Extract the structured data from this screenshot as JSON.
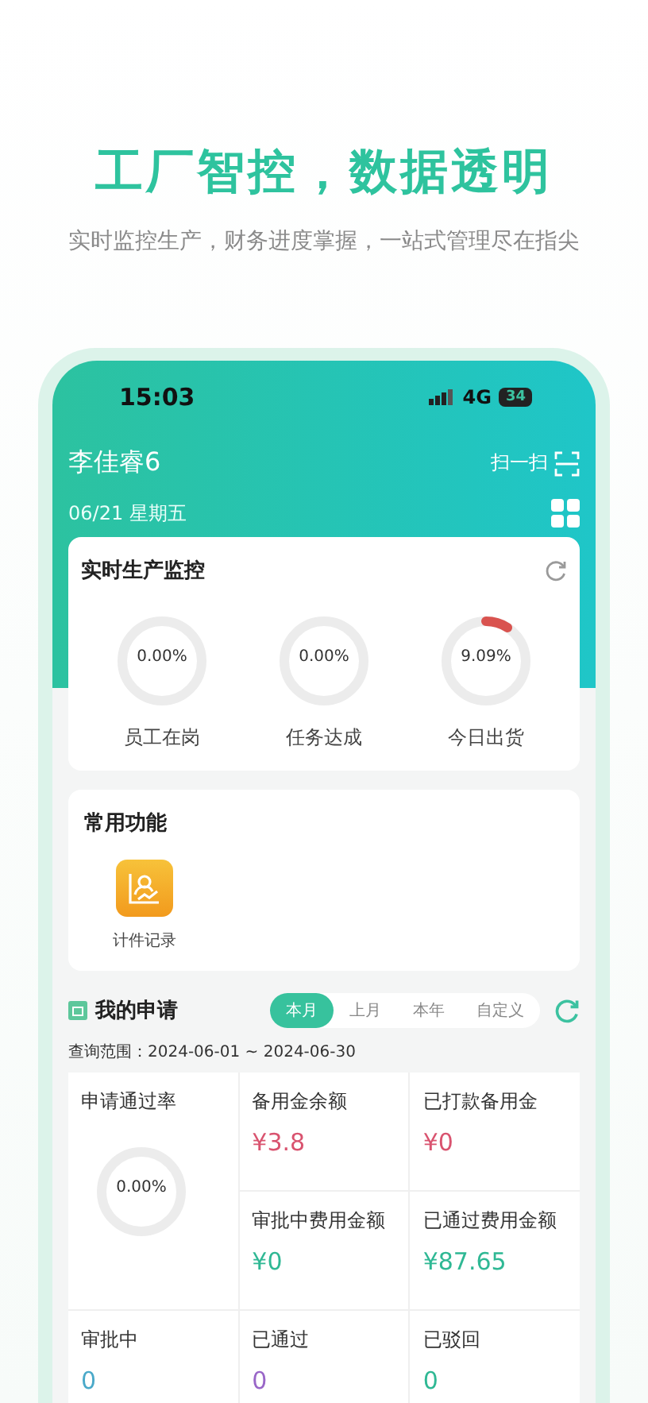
{
  "headline": "工厂智控，数据透明",
  "subtitle": "实时监控生产，财务进度掌握，一站式管理尽在指尖",
  "status_bar": {
    "time": "15:03",
    "network": "4G",
    "battery": "34"
  },
  "header": {
    "user": "李佳睿6",
    "scan": "扫一扫",
    "date": "06/21 星期五"
  },
  "monitor": {
    "title": "实时生产监控",
    "gauges": [
      {
        "value": "0.00%",
        "label": "员工在岗"
      },
      {
        "value": "0.00%",
        "label": "任务达成"
      },
      {
        "value": "9.09%",
        "label": "今日出货",
        "level": 0.0909
      }
    ]
  },
  "functions": {
    "title": "常用功能",
    "items": [
      {
        "label": "计件记录"
      }
    ]
  },
  "applications": {
    "title": "我的申请",
    "tabs": [
      {
        "label": "本月",
        "selected": true
      },
      {
        "label": "上月",
        "selected": false
      },
      {
        "label": "本年",
        "selected": false
      },
      {
        "label": "自定义",
        "selected": false
      }
    ],
    "range": "查询范围：2024-06-01 ~ 2024-06-30",
    "pass_rate": {
      "label": "申请通过率",
      "value": "0.00%"
    },
    "amounts": [
      {
        "label": "备用金余额",
        "value": "¥3.8",
        "color": "#d9536f"
      },
      {
        "label": "已打款备用金",
        "value": "¥0",
        "color": "#d9536f"
      },
      {
        "label": "审批中费用金额",
        "value": "¥0",
        "color": "#2fb894"
      },
      {
        "label": "已通过费用金额",
        "value": "¥87.65",
        "color": "#2fb894"
      }
    ],
    "statuses": [
      {
        "label": "审批中",
        "value": "0",
        "color": "#4aa9c9"
      },
      {
        "label": "已通过",
        "value": "0",
        "color": "#9966c8"
      },
      {
        "label": "已驳回",
        "value": "0",
        "color": "#2fb894"
      }
    ]
  }
}
